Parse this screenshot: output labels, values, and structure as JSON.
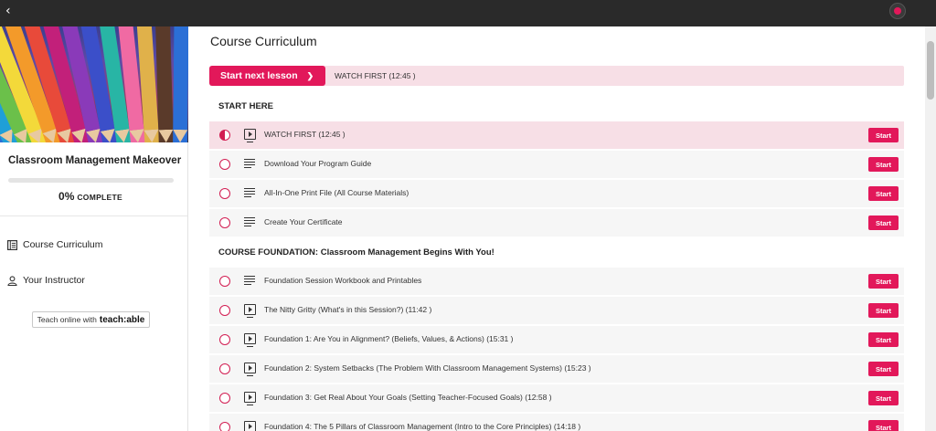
{
  "topbar": {
    "back_icon": "chevron-left-icon",
    "avatar_icon": "user-avatar-icon"
  },
  "sidebar": {
    "course_title": "Classroom Management Makeover",
    "progress": {
      "percent_text": "0%",
      "word": "COMPLETE",
      "value": 0
    },
    "nav": [
      {
        "label": "Course Curriculum",
        "icon": "curriculum-icon"
      },
      {
        "label": "Your Instructor",
        "icon": "person-icon"
      }
    ],
    "teach_badge": {
      "prefix": "Teach online with",
      "brand": "teach:able"
    }
  },
  "main": {
    "title": "Course Curriculum",
    "next": {
      "button_label": "Start next lesson",
      "lesson_label": "WATCH FIRST (12:45 )"
    },
    "sections": [
      {
        "title": "START HERE",
        "lectures": [
          {
            "title": "WATCH FIRST (12:45 )",
            "type": "video",
            "status": "in-progress",
            "button": "Start"
          },
          {
            "title": "Download Your Program Guide",
            "type": "text",
            "status": "not-started",
            "button": "Start"
          },
          {
            "title": "All-In-One Print File (All Course Materials)",
            "type": "text",
            "status": "not-started",
            "button": "Start"
          },
          {
            "title": "Create Your Certificate",
            "type": "text",
            "status": "not-started",
            "button": "Start"
          }
        ]
      },
      {
        "title": "COURSE FOUNDATION: Classroom Management Begins With You!",
        "lectures": [
          {
            "title": "Foundation Session Workbook and Printables",
            "type": "text",
            "status": "not-started",
            "button": "Start"
          },
          {
            "title": "The Nitty Gritty (What's in this Session?) (11:42 )",
            "type": "video",
            "status": "not-started",
            "button": "Start"
          },
          {
            "title": "Foundation 1: Are You in Alignment? (Beliefs, Values, & Actions) (15:31 )",
            "type": "video",
            "status": "not-started",
            "button": "Start"
          },
          {
            "title": "Foundation 2: System Setbacks (The Problem With Classroom Management Systems) (15:23 )",
            "type": "video",
            "status": "not-started",
            "button": "Start"
          },
          {
            "title": "Foundation 3: Get Real About Your Goals (Setting Teacher-Focused Goals) (12:58 )",
            "type": "video",
            "status": "not-started",
            "button": "Start"
          },
          {
            "title": "Foundation 4: The 5 Pillars of Classroom Management (Intro to the Core Principles) (14:18 )",
            "type": "video",
            "status": "not-started",
            "button": "Start"
          }
        ]
      }
    ]
  },
  "colors": {
    "accent": "#e2185a",
    "active_row": "#f7dfe6",
    "row": "#f6f6f6",
    "topbar": "#2a2a2a"
  }
}
